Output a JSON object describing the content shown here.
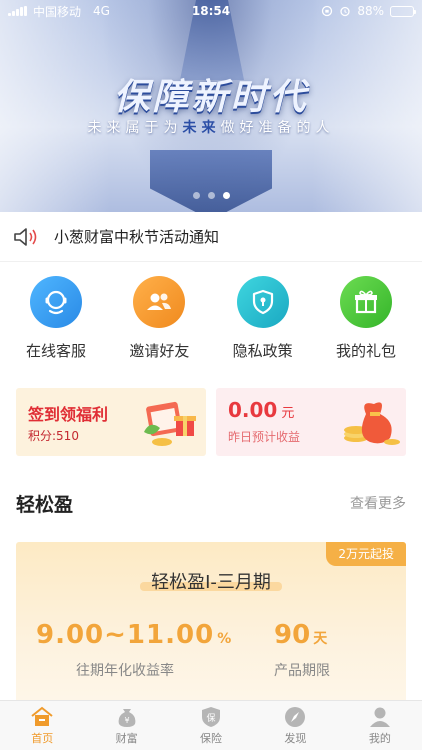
{
  "status_bar": {
    "carrier": "中国移动",
    "network": "4G",
    "time": "18:54",
    "battery": "88%",
    "battery_level": 0.88
  },
  "banner": {
    "title": "保障新时代",
    "subtitle_before": "未来属于为",
    "subtitle_highlight": "未来",
    "subtitle_after": "做好准备的人",
    "slide_count": 3,
    "active_slide": 2
  },
  "notice": {
    "text": "小葱财富中秋节活动通知",
    "icon": "speaker-icon"
  },
  "quick_actions": [
    {
      "label": "在线客服",
      "icon": "customer-service-icon",
      "color": "#3aa0f0"
    },
    {
      "label": "邀请好友",
      "icon": "invite-friends-icon",
      "color": "#f59a30"
    },
    {
      "label": "隐私政策",
      "icon": "privacy-shield-icon",
      "color": "#2bbfd0"
    },
    {
      "label": "我的礼包",
      "icon": "gift-icon",
      "color": "#4fc83e"
    }
  ],
  "promo": {
    "signin": {
      "title": "签到领福利",
      "points_label": "积分:510"
    },
    "earnings": {
      "amount": "0.00",
      "unit": "元",
      "label": "昨日预计收益"
    }
  },
  "section": {
    "title": "轻松盈",
    "more": "查看更多"
  },
  "product": {
    "badge": "2万元起投",
    "name": "轻松盈I-三月期",
    "rate": "9.00~11.00",
    "rate_unit": "%",
    "rate_label": "往期年化收益率",
    "period": "90",
    "period_unit": "天",
    "period_label": "产品期限"
  },
  "tabbar": [
    {
      "label": "首页",
      "icon": "home-icon",
      "active": true
    },
    {
      "label": "财富",
      "icon": "wealth-icon",
      "active": false
    },
    {
      "label": "保险",
      "icon": "insurance-icon",
      "active": false
    },
    {
      "label": "发现",
      "icon": "discover-compass-icon",
      "active": false
    },
    {
      "label": "我的",
      "icon": "profile-icon",
      "active": false
    }
  ],
  "colors": {
    "accent": "#f09b2c",
    "red": "#e02e35",
    "product_gold": "#f2a53b"
  }
}
